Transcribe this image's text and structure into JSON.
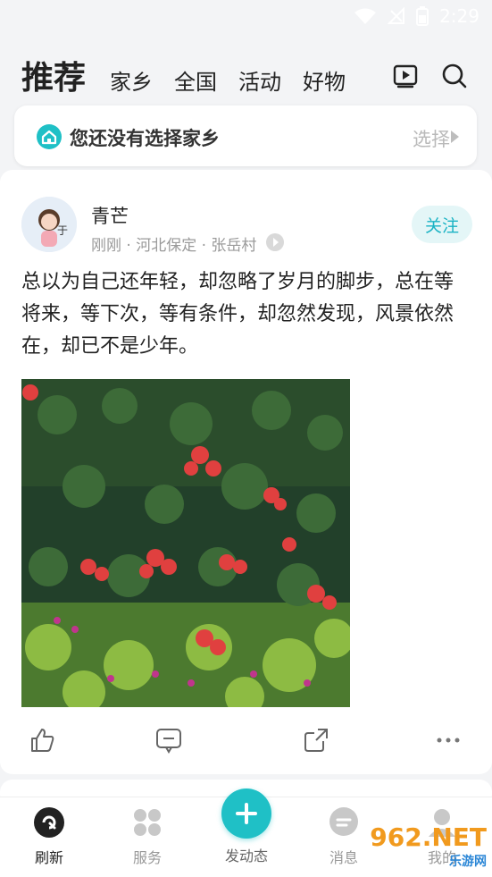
{
  "status": {
    "time": "2:29"
  },
  "header": {
    "title": "推荐",
    "tabs": [
      "家乡",
      "全国",
      "活动",
      "好物"
    ],
    "icons": [
      "video-icon",
      "search-icon"
    ]
  },
  "hometown_card": {
    "text": "您还没有选择家乡",
    "action": "选择"
  },
  "post": {
    "username": "青芒",
    "meta": "刚刚 · 河北保定 · 张岳村",
    "follow_label": "关注",
    "text": "总以为自己还年轻，却忽略了岁月的脚步，总在等将来，等下次，等有条件，却忽然发现，风景依然在，却已不是少年。",
    "actions": [
      "like-icon",
      "comment-icon",
      "share-icon",
      "more-icon"
    ]
  },
  "bottom_nav": {
    "items": [
      {
        "label": "刷新",
        "icon": "refresh-icon",
        "active": true
      },
      {
        "label": "服务",
        "icon": "grid-icon",
        "active": false
      },
      {
        "label": "发动态",
        "icon": "plus-icon",
        "active": false
      },
      {
        "label": "消息",
        "icon": "message-icon",
        "active": false
      },
      {
        "label": "我的",
        "icon": "profile-icon",
        "active": false
      }
    ]
  },
  "watermark": {
    "main": "962.NET",
    "sub": "乐游网"
  },
  "colors": {
    "accent": "#1fc0c6",
    "follow_text": "#1ab3c4",
    "follow_bg": "#e4f6f7"
  }
}
